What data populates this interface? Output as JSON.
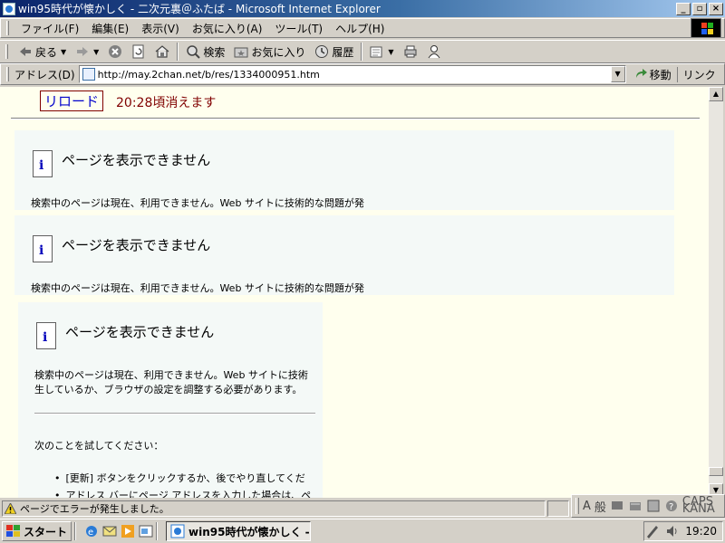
{
  "window": {
    "title": "win95時代が懐かしく - 二次元裏＠ふたば - Microsoft Internet Explorer",
    "buttons": [
      "_",
      "▫",
      "×"
    ]
  },
  "menu": {
    "items": [
      "ファイル(F)",
      "編集(E)",
      "表示(V)",
      "お気に入り(A)",
      "ツール(T)",
      "ヘルプ(H)"
    ]
  },
  "toolbar": {
    "back_label": "戻る",
    "search_label": "検索",
    "favorites_label": "お気に入り",
    "history_label": "履歴"
  },
  "address": {
    "label": "アドレス(D)",
    "url": "http://may.2chan.net/b/res/1334000951.htm",
    "go_label": "移動",
    "links_label": "リンク"
  },
  "page": {
    "reload_label": "リロード",
    "expiry_text": "20:28頃消えます",
    "frames": [
      {
        "title": "ページを表示できません",
        "body": "検索中のページは現在、利用できません。Web サイトに技術的な問題が発"
      },
      {
        "title": "ページを表示できません",
        "body": "検索中のページは現在、利用できません。Web サイトに技術的な問題が発"
      },
      {
        "title": "ページを表示できません",
        "body_line1": "検索中のページは現在、利用できません。Web サイトに技術",
        "body_line2": "生しているか、ブラウザの設定を調整する必要があります。",
        "try_text": "次のことを試してください：",
        "bullet1": "[更新] ボタンをクリックするか、後でやり直してくだ",
        "bullet2": "アドレス バーにページ アドレスを入力した場合は、ペ"
      }
    ]
  },
  "status": {
    "text": "ページでエラーが発生しました。"
  },
  "ime": {
    "mode_label": "般",
    "caps_label": "CAPS",
    "kana_label": "KANA"
  },
  "taskbar": {
    "start_label": "スタート",
    "task_label": "win95時代が懐かしく -...",
    "clock": "19:20"
  }
}
